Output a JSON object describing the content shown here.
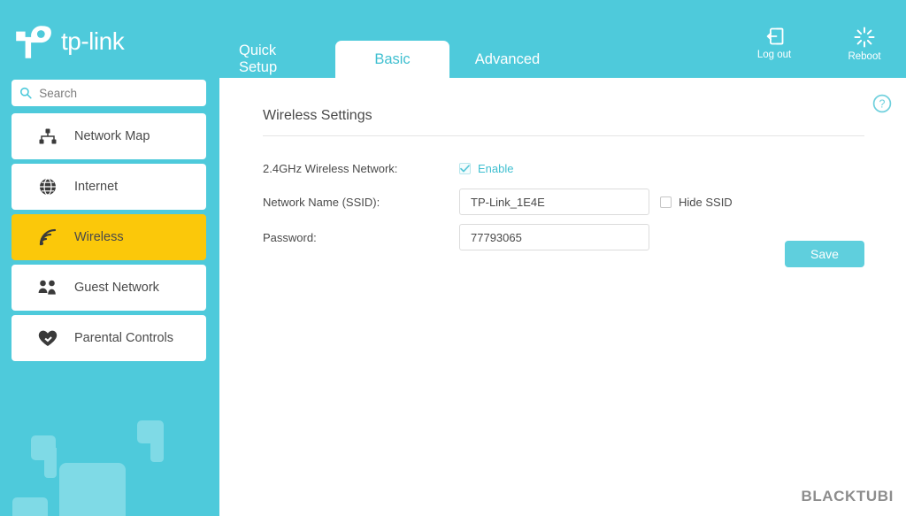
{
  "brand": {
    "name": "tp-link",
    "logo_icon": "tp-link-logo-icon"
  },
  "sidebar": {
    "search": {
      "placeholder": "Search",
      "value": "",
      "icon": "search-icon"
    },
    "items": [
      {
        "label": "Network Map",
        "icon": "network-map-icon",
        "active": false
      },
      {
        "label": "Internet",
        "icon": "globe-icon",
        "active": false
      },
      {
        "label": "Wireless",
        "icon": "wireless-signal-icon",
        "active": true
      },
      {
        "label": "Guest Network",
        "icon": "guest-users-icon",
        "active": false
      },
      {
        "label": "Parental Controls",
        "icon": "heart-icon",
        "active": false
      }
    ]
  },
  "topbar": {
    "tabs": [
      {
        "label": "Quick Setup",
        "active": false
      },
      {
        "label": "Basic",
        "active": true
      },
      {
        "label": "Advanced",
        "active": false
      }
    ],
    "actions": [
      {
        "label": "Log out",
        "icon": "logout-icon"
      },
      {
        "label": "Reboot",
        "icon": "reboot-icon"
      }
    ]
  },
  "main": {
    "panel_title": "Wireless Settings",
    "help_icon": "help-circle-icon",
    "fields": {
      "wireless_network": {
        "label": "2.4GHz Wireless Network:",
        "checkbox_label": "Enable",
        "checked": true
      },
      "ssid": {
        "label": "Network Name (SSID):",
        "value": "TP-Link_1E4E",
        "hide_label": "Hide SSID",
        "hide_checked": false
      },
      "password": {
        "label": "Password:",
        "value": "77793065"
      }
    },
    "save_label": "Save"
  },
  "watermark": "BLACKTUBI",
  "colors": {
    "teal": "#4ecadb",
    "teal_text": "#3fbfd0",
    "yellow": "#fbc80a",
    "save_button": "#5fcfdd",
    "text_dark": "#4a4a4a",
    "watermark_gray": "#8d8d8d"
  }
}
